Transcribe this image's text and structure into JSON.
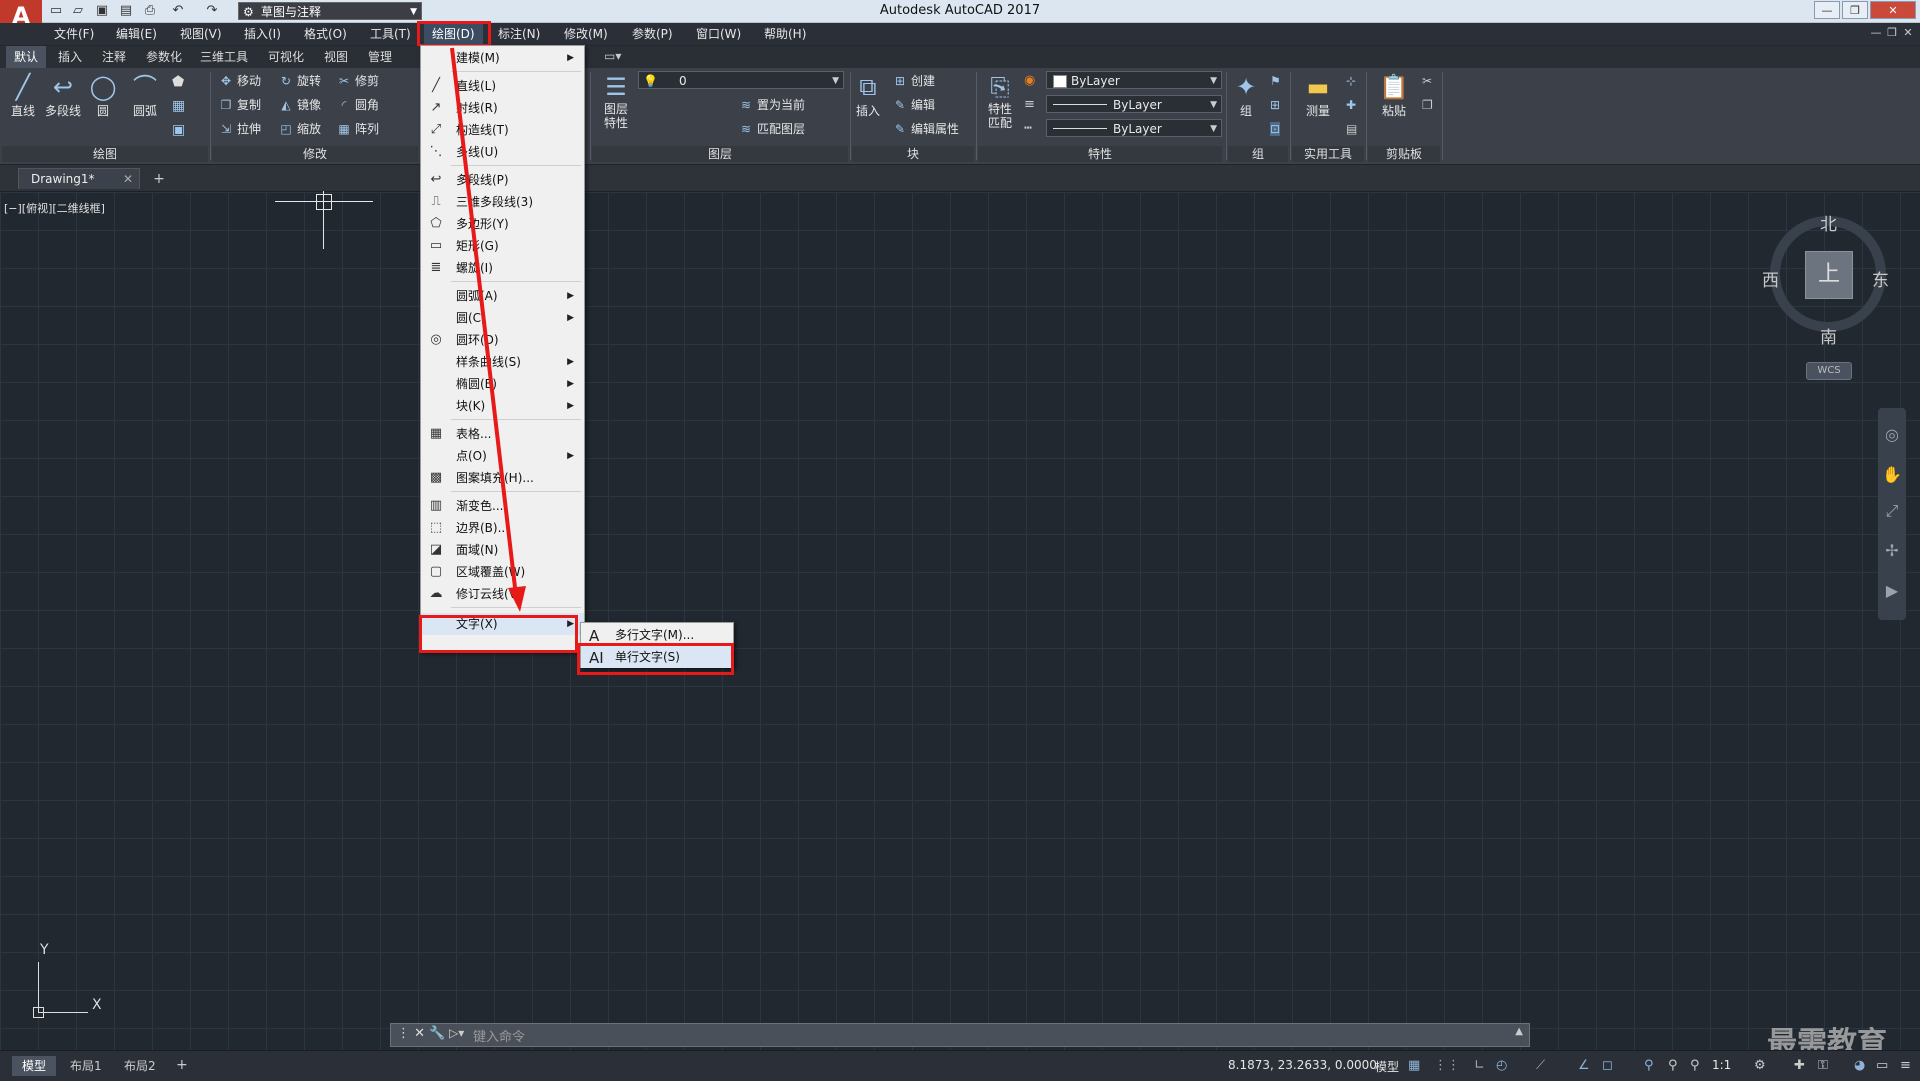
{
  "window": {
    "logo": "A",
    "title": "Autodesk AutoCAD 2017",
    "workspace": "草图与注释",
    "controls": {
      "minimize": "—",
      "restore": "❐",
      "close": "✕"
    }
  },
  "menubar": [
    "文件(F)",
    "编辑(E)",
    "视图(V)",
    "插入(I)",
    "格式(O)",
    "工具(T)",
    "绘图(D)",
    "标注(N)",
    "修改(M)",
    "参数(P)",
    "窗口(W)",
    "帮助(H)"
  ],
  "ribbon_tabs": [
    "默认",
    "插入",
    "注释",
    "参数化",
    "三维工具",
    "可视化",
    "视图",
    "管理"
  ],
  "ribbon": {
    "draw": {
      "title": "绘图",
      "line": "直线",
      "polyline": "多段线",
      "circle": "圆",
      "arc": "圆弧"
    },
    "modify": {
      "title": "修改",
      "move": "移动",
      "rotate": "旋转",
      "trim": "修剪",
      "copy": "复制",
      "mirror": "镜像",
      "fillet": "圆角",
      "stretch": "拉伸",
      "scale": "缩放",
      "array": "阵列"
    },
    "layers": {
      "title": "图层",
      "properties": "图层\n特性",
      "props_line1": "图层",
      "props_line2": "特性",
      "current_layer": "0",
      "set_current": "置为当前",
      "match_layer": "匹配图层"
    },
    "block": {
      "title": "块",
      "insert": "插入",
      "create": "创建",
      "edit": "编辑",
      "edit_attr": "编辑属性"
    },
    "properties": {
      "title": "特性",
      "match_line1": "特性",
      "match_line2": "匹配",
      "color": "ByLayer",
      "linetype": "ByLayer",
      "lineweight": "ByLayer"
    },
    "groups": {
      "title": "组",
      "group": "组"
    },
    "utilities": {
      "title": "实用工具",
      "measure": "测量"
    },
    "clipboard": {
      "title": "剪贴板",
      "paste": "粘贴"
    }
  },
  "file_tab": {
    "name": "Drawing1*",
    "close": "✕",
    "new": "+"
  },
  "viewport_label": "[−][俯视][二维线框]",
  "viewcube": {
    "north": "北",
    "south": "南",
    "east": "东",
    "west": "西",
    "face": "上",
    "wcs": "WCS"
  },
  "ucs": {
    "x": "X",
    "y": "Y"
  },
  "command": {
    "placeholder": "键入命令"
  },
  "layout_tabs": [
    "模型",
    "布局1",
    "布局2"
  ],
  "status": {
    "coords": "8.1873, 23.2633, 0.0000",
    "model": "模型",
    "scale": "1:1"
  },
  "watermark": "最需教育",
  "draw_menu": {
    "items": [
      {
        "label": "建模(M)",
        "icon": "",
        "submenu": true
      },
      {
        "label": "直线(L)",
        "icon": "line-icon",
        "submenu": false
      },
      {
        "label": "射线(R)",
        "icon": "ray-icon",
        "submenu": false
      },
      {
        "label": "构造线(T)",
        "icon": "xline-icon",
        "submenu": false
      },
      {
        "label": "多线(U)",
        "icon": "mline-icon",
        "submenu": false
      },
      {
        "label": "多段线(P)",
        "icon": "polyline-icon",
        "submenu": false
      },
      {
        "label": "三维多段线(3)",
        "icon": "3dpoly-icon",
        "submenu": false
      },
      {
        "label": "多边形(Y)",
        "icon": "polygon-icon",
        "submenu": false
      },
      {
        "label": "矩形(G)",
        "icon": "rectangle-icon",
        "submenu": false
      },
      {
        "label": "螺旋(I)",
        "icon": "helix-icon",
        "submenu": false
      },
      {
        "label": "圆弧(A)",
        "icon": "",
        "submenu": true
      },
      {
        "label": "圆(C)",
        "icon": "",
        "submenu": true
      },
      {
        "label": "圆环(D)",
        "icon": "donut-icon",
        "submenu": false
      },
      {
        "label": "样条曲线(S)",
        "icon": "",
        "submenu": true
      },
      {
        "label": "椭圆(E)",
        "icon": "",
        "submenu": true
      },
      {
        "label": "块(K)",
        "icon": "",
        "submenu": true
      },
      {
        "label": "表格...",
        "icon": "table-icon",
        "submenu": false
      },
      {
        "label": "点(O)",
        "icon": "",
        "submenu": true
      },
      {
        "label": "图案填充(H)...",
        "icon": "hatch-icon",
        "submenu": false
      },
      {
        "label": "渐变色...",
        "icon": "gradient-icon",
        "submenu": false
      },
      {
        "label": "边界(B)...",
        "icon": "boundary-icon",
        "submenu": false
      },
      {
        "label": "面域(N)",
        "icon": "region-icon",
        "submenu": false
      },
      {
        "label": "区域覆盖(W)",
        "icon": "wipeout-icon",
        "submenu": false
      },
      {
        "label": "修订云线(V)",
        "icon": "revcloud-icon",
        "submenu": false
      },
      {
        "label": "文字(X)",
        "icon": "",
        "submenu": true
      }
    ]
  },
  "text_submenu": [
    {
      "label": "多行文字(M)...",
      "icon": "A"
    },
    {
      "label": "单行文字(S)",
      "icon": "AI"
    }
  ],
  "colors": {
    "highlight_box": "#e81919",
    "canvas": "#212830",
    "menu_bg": "#f0f0f0"
  }
}
